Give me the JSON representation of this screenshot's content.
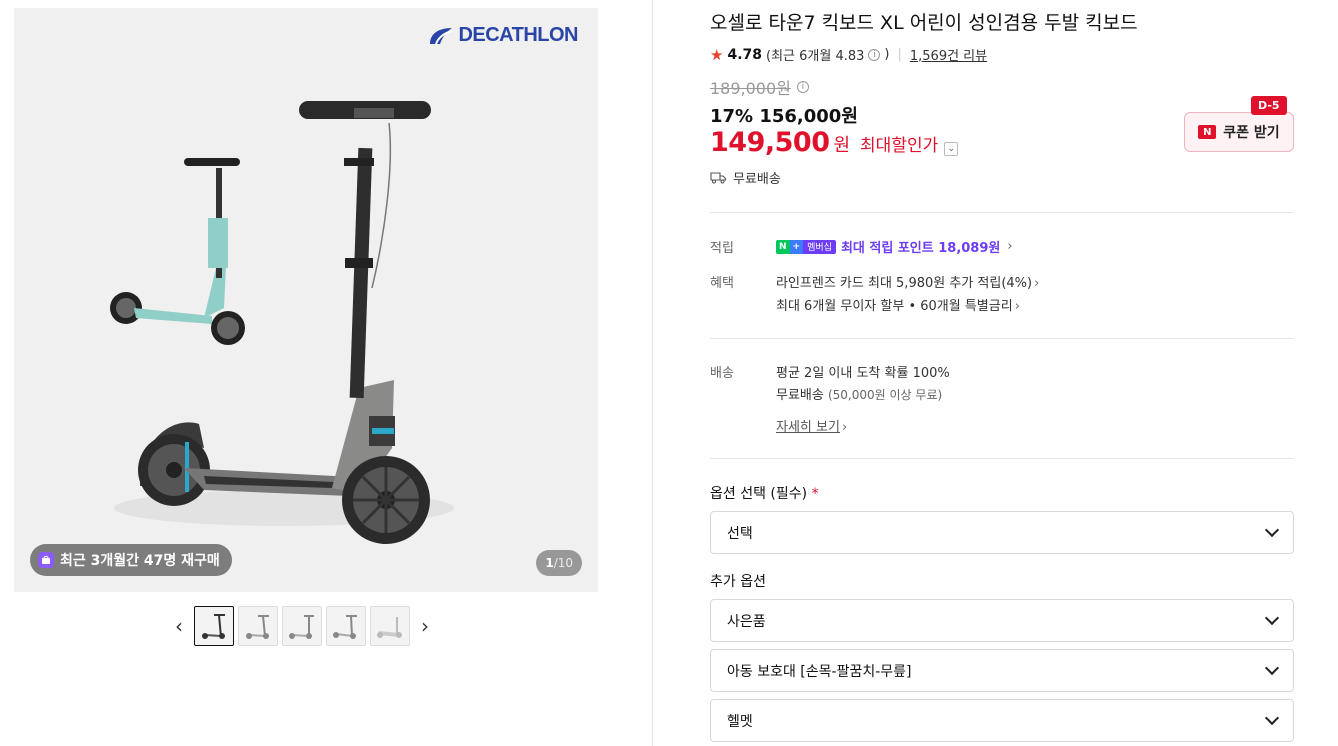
{
  "gallery": {
    "brand": "DECATHLON",
    "rebuy_badge": "최근 3개월간 47명 재구매",
    "counter_current": "1",
    "counter_total": "/10",
    "prev_arrow": "‹",
    "next_arrow": "›"
  },
  "product": {
    "title": "오셀로 타운7 킥보드 XL 어린이 성인겸용 두발 킥보드",
    "rating": "4.78",
    "rating_sub_open": "(최근 6개월 4.83",
    "rating_sub_close": ")",
    "review_count": "1,569건 리뷰",
    "original_price": "189,000원",
    "discount_line": "17% 156,000원",
    "final_amount": "149,500",
    "final_currency": "원",
    "final_label": "최대할인가",
    "shipping": "무료배송"
  },
  "coupon": {
    "d_badge": "D-5",
    "n_icon": "N",
    "label": "쿠폰 받기"
  },
  "benefits": {
    "points_label": "적립",
    "npay_n": "N",
    "npay_plus": "+",
    "npay_membership": "멤버십",
    "points_text": "최대 적립 포인트 18,089원",
    "benefit_label": "혜택",
    "card_text": "라인프렌즈 카드 최대 5,980원 추가 적립(4%)",
    "installment_text": "최대 6개월 무이자 할부 • 60개월 특별금리"
  },
  "delivery": {
    "label": "배송",
    "line1": "평균 2일 이내 도착 확률 100%",
    "line2_main": "무료배송",
    "line2_sub": "(50,000원 이상 무료)",
    "detail_link": "자세히 보기"
  },
  "options": {
    "required_label": "옵션 선택 (필수)",
    "required_mark": "*",
    "required_select": "선택",
    "extra_label": "추가 옵션",
    "extra_items": [
      "사은품",
      "아동 보호대 [손목-팔꿈치-무릎]",
      "헬멧"
    ]
  },
  "colors": {
    "accent_red": "#e0112b",
    "point_purple": "#6c3df4",
    "brand_blue": "#2a45a8"
  }
}
